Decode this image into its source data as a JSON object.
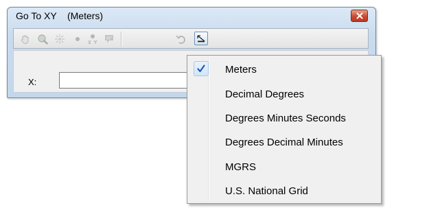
{
  "window": {
    "title": "Go To XY    (Meters)"
  },
  "toolbar": {
    "buttons": [
      {
        "name": "pan-to-icon",
        "enabled": false
      },
      {
        "name": "zoom-to-icon",
        "enabled": false
      },
      {
        "name": "flash-icon",
        "enabled": false
      },
      {
        "name": "add-point-icon",
        "enabled": false
      },
      {
        "name": "add-labeled-point-icon",
        "enabled": false
      },
      {
        "name": "add-callout-icon",
        "enabled": false
      },
      {
        "name": "recent-locations-icon",
        "enabled": false
      },
      {
        "name": "units-icon",
        "enabled": true
      }
    ]
  },
  "fields": {
    "x_label": "X:",
    "x_value": ""
  },
  "units_menu": {
    "items": [
      {
        "label": "Meters",
        "checked": true
      },
      {
        "label": "Decimal Degrees",
        "checked": false
      },
      {
        "label": "Degrees Minutes Seconds",
        "checked": false
      },
      {
        "label": "Degrees Decimal Minutes",
        "checked": false
      },
      {
        "label": "MGRS",
        "checked": false
      },
      {
        "label": "U.S. National Grid",
        "checked": false
      }
    ]
  },
  "colors": {
    "check_mark": "#1a5fb4",
    "close_button": "#c84a32",
    "disabled_icon": "#b5b5b5"
  }
}
